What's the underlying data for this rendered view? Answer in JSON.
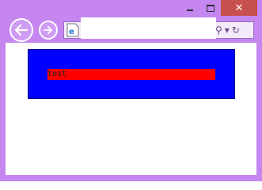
{
  "window": {
    "frame_color": "#c586f0",
    "close_button_color": "#c7504f"
  },
  "toolbar": {
    "back_icon": "back-arrow-icon",
    "forward_icon": "forward-arrow-icon",
    "page_icon": "ie-page-icon",
    "search_icon": "search-icon",
    "dropdown_icon": "chevron-down-icon",
    "refresh_icon": "refresh-icon"
  },
  "content": {
    "outer_box_color": "#0000ff",
    "bar_color": "#ff0000",
    "bar_text": "test"
  }
}
